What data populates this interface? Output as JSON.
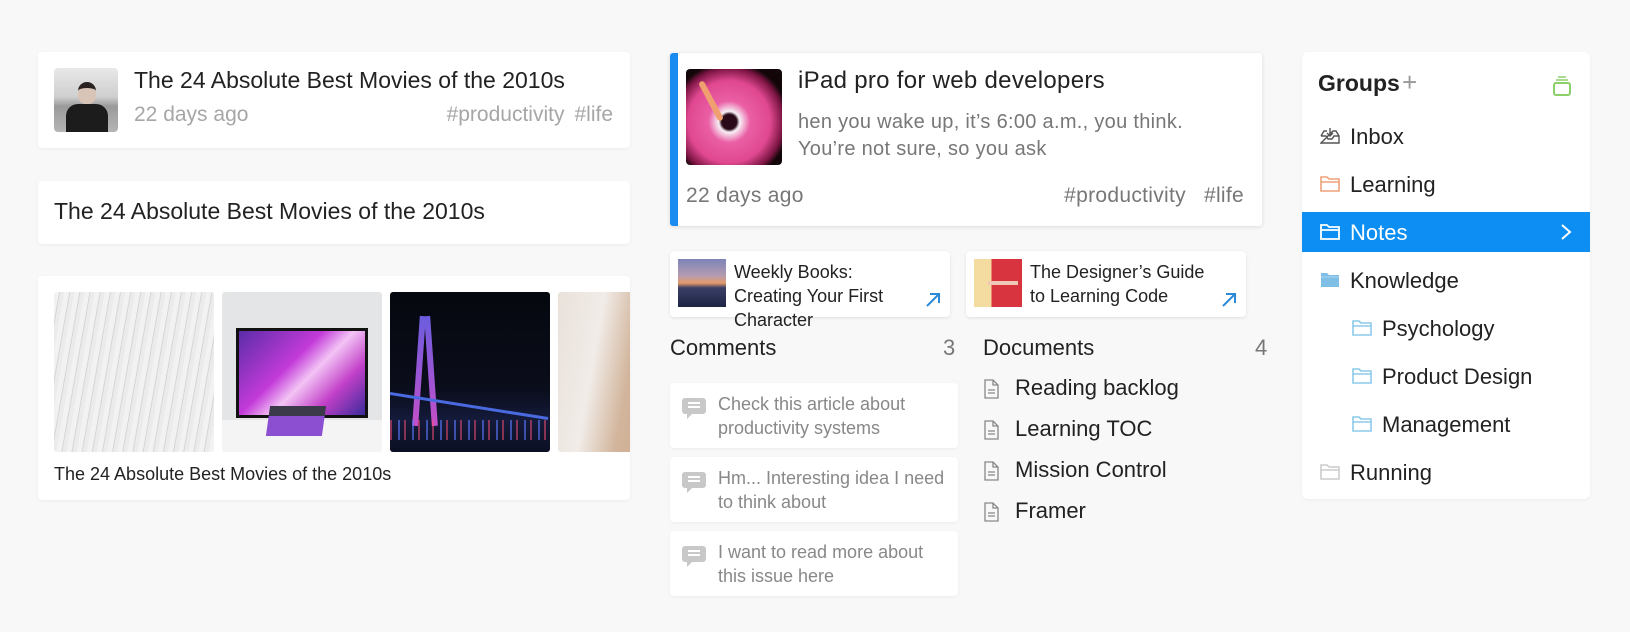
{
  "left": {
    "card_a": {
      "title": "The 24 Absolute Best Movies of the 2010s",
      "date": "22 days ago",
      "tags": [
        "#productivity",
        "#life"
      ]
    },
    "card_b": {
      "title": "The 24 Absolute Best Movies of the 2010s"
    },
    "card_c": {
      "images": [
        "architecture-lines",
        "desk-setup",
        "bridge-night",
        "sand-aerial"
      ],
      "title": "The 24 Absolute Best Movies of the 2010s"
    }
  },
  "featured": {
    "title": "iPad pro for web developers",
    "excerpt": "hen you wake up, it’s 6:00 a.m., you think. You’re not sure, so you ask",
    "date": "22 days ago",
    "tags": [
      "#productivity",
      "#life"
    ],
    "accent_color": "#1a8cf0"
  },
  "links": [
    {
      "title": "Weekly Books: Creating Your First Character",
      "icon": "external-arrow-icon"
    },
    {
      "title": "The Designer’s Guide to Learning Code",
      "icon": "external-arrow-icon"
    }
  ],
  "comments": {
    "heading": "Comments",
    "count": "3",
    "items": [
      "Check this article about productivity systems",
      "Hm... Interesting idea I need to think about",
      "I want to read more about this issue here"
    ]
  },
  "documents": {
    "heading": "Documents",
    "count": "4",
    "items": [
      "Reading backlog",
      "Learning TOC",
      "Mission Control",
      "Framer"
    ]
  },
  "groups": {
    "heading": "Groups",
    "add_label": "+",
    "items": [
      {
        "label": "Inbox",
        "icon": "inbox-icon",
        "color": "#555555"
      },
      {
        "label": "Learning",
        "icon": "folder-icon",
        "color": "#f0a27a"
      },
      {
        "label": "Notes",
        "icon": "folder-icon",
        "color": "#ffffff",
        "active": true
      },
      {
        "label": "Knowledge",
        "icon": "folder-filled-icon",
        "color": "#7fbfe6"
      },
      {
        "label": "Psychology",
        "icon": "folder-icon",
        "color": "#8ccaeb",
        "indent": 1
      },
      {
        "label": "Product Design",
        "icon": "folder-icon",
        "color": "#8ccaeb",
        "indent": 1
      },
      {
        "label": "Management",
        "icon": "folder-icon",
        "color": "#8ccaeb",
        "indent": 1
      },
      {
        "label": "Running",
        "icon": "folder-icon",
        "color": "#cccccc"
      }
    ],
    "active_color": "#0d8ef2",
    "stack_icon_color": "#8cd06a"
  }
}
